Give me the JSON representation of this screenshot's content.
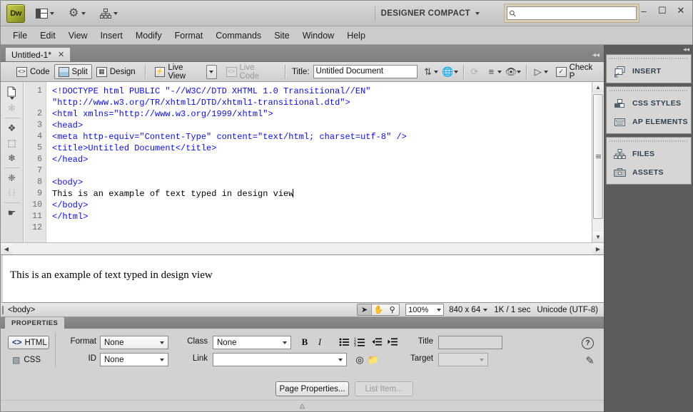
{
  "titlebar": {
    "logo": "Dw",
    "logo_icon": "dreamweaver-logo",
    "layout_icon": "layout-switcher-icon",
    "extend_icon": "gear-icon",
    "site_icon": "site-manage-icon",
    "workspace": "DESIGNER COMPACT",
    "search_placeholder": "",
    "search_value": "",
    "search_icon": "search-icon",
    "minimize": "–",
    "maximize": "☐",
    "close": "✕"
  },
  "menubar": {
    "items": [
      "File",
      "Edit",
      "View",
      "Insert",
      "Modify",
      "Format",
      "Commands",
      "Site",
      "Window",
      "Help"
    ]
  },
  "doctab": {
    "title": "Untitled-1*",
    "close": "✕",
    "collapse": "◂◂"
  },
  "toolbar": {
    "code_label": "Code",
    "split_label": "Split",
    "design_label": "Design",
    "live_view_label": "Live View",
    "live_code_label": "Live Code",
    "title_label": "Title:",
    "title_value": "Untitled Document",
    "title_placeholder": "",
    "file_management_icon": "file-management-icon",
    "preview_icon": "preview-browser-icon",
    "refresh_icon": "refresh-icon",
    "view_options_icon": "view-options-icon",
    "visual_aids_icon": "visual-aids-icon",
    "validate_icon": "validate-markup-icon",
    "check_page_icon": "check-page-icon",
    "check_page_label": "Check P"
  },
  "code_gutter": {
    "icons": [
      {
        "name": "open-documents-icon",
        "glyph": "❐",
        "disabled": false
      },
      {
        "name": "file-management-icon",
        "glyph": "✻",
        "disabled": true
      },
      {
        "name": "collapse-full-tag-icon",
        "glyph": "❖",
        "disabled": false
      },
      {
        "name": "collapse-selection-icon",
        "glyph": "⬚",
        "disabled": false
      },
      {
        "name": "expand-all-icon",
        "glyph": "❄",
        "disabled": false
      },
      {
        "name": "select-parent-tag-icon",
        "glyph": "◈",
        "disabled": false
      },
      {
        "name": "balance-braces-icon",
        "glyph": "{ }",
        "disabled": true
      },
      {
        "name": "more-options-icon",
        "glyph": "»",
        "disabled": false
      }
    ]
  },
  "code": {
    "line_numbers": [
      "1",
      "",
      "2",
      "3",
      "4",
      "5",
      "6",
      "7",
      "8",
      "9",
      "10",
      "11",
      "12"
    ],
    "lines": [
      "<!DOCTYPE html PUBLIC \"-//W3C//DTD XHTML 1.0 Transitional//EN\"",
      "\"http://www.w3.org/TR/xhtml1/DTD/xhtml1-transitional.dtd\">",
      "<html xmlns=\"http://www.w3.org/1999/xhtml\">",
      "<head>",
      "<meta http-equiv=\"Content-Type\" content=\"text/html; charset=utf-8\" />",
      "<title>Untitled Document</title>",
      "</head>",
      "",
      "<body>",
      "This is an example of text typed in design view",
      "</body>",
      "</html>",
      ""
    ],
    "plain_line_index": 9,
    "cursor_line_index": 9
  },
  "design": {
    "text": "This is an example of text typed in design view"
  },
  "statusbar": {
    "tag_selector": "<body>",
    "select_tool_icon": "select-arrow-icon",
    "hand_tool_icon": "hand-icon",
    "zoom_tool_icon": "zoom-icon",
    "zoom_value": "100%",
    "window_size": "840 x 64",
    "doc_size": "1K / 1 sec",
    "encoding": "Unicode (UTF-8)"
  },
  "properties": {
    "panel_title": "PROPERTIES",
    "html_button": "HTML",
    "css_button": "CSS",
    "format_label": "Format",
    "format_value": "None",
    "id_label": "ID",
    "id_value": "None",
    "class_label": "Class",
    "class_value": "None",
    "link_label": "Link",
    "link_value": "",
    "bold": "B",
    "italic": "I",
    "unordered_list_icon": "unordered-list-icon",
    "ordered_list_icon": "ordered-list-icon",
    "outdent_icon": "outdent-icon",
    "indent_icon": "indent-icon",
    "title_label": "Title",
    "title_value": "",
    "target_label": "Target",
    "target_value": "",
    "browse_icon": "point-to-file-icon",
    "folder_icon": "browse-folder-icon",
    "page_properties_button": "Page Properties...",
    "list_item_button": "List Item...",
    "help_icon": "help-icon",
    "edit_icon": "quick-edit-icon",
    "grip": "△"
  },
  "dock": {
    "collapse_icon": "◂◂",
    "groups": [
      {
        "items": [
          {
            "label": "INSERT",
            "icon": "insert-panel-icon",
            "glyph": "❐"
          }
        ]
      },
      {
        "items": [
          {
            "label": "CSS STYLES",
            "icon": "css-styles-icon",
            "glyph": "◧"
          },
          {
            "label": "AP ELEMENTS",
            "icon": "ap-elements-icon",
            "glyph": "▤"
          }
        ]
      },
      {
        "items": [
          {
            "label": "FILES",
            "icon": "files-panel-icon",
            "glyph": "⛭"
          },
          {
            "label": "ASSETS",
            "icon": "assets-panel-icon",
            "glyph": "Ὃc"
          }
        ]
      }
    ]
  }
}
